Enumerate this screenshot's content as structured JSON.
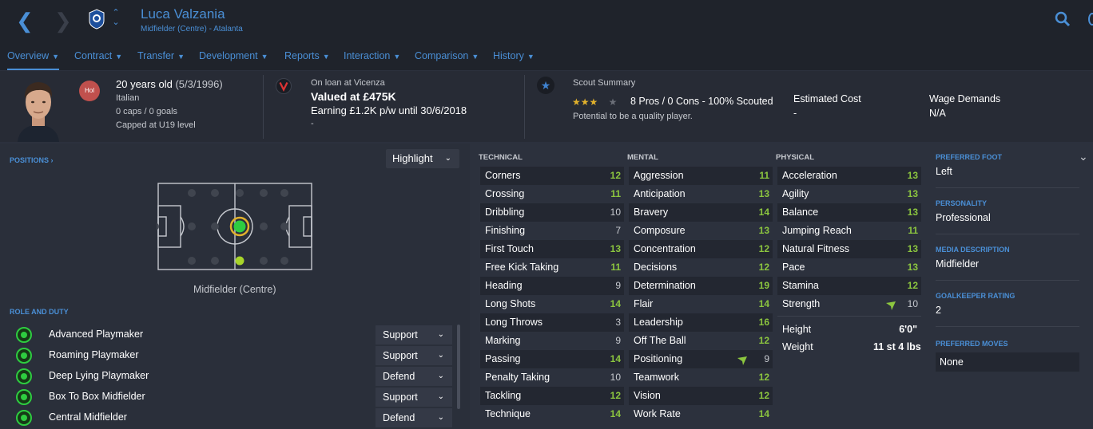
{
  "header": {
    "name": "Luca Valzania",
    "subtitle": "Midfielder (Centre) - Atalanta"
  },
  "tabs": [
    {
      "label": "Overview"
    },
    {
      "label": "Contract"
    },
    {
      "label": "Transfer"
    },
    {
      "label": "Development"
    },
    {
      "label": "Reports"
    },
    {
      "label": "Interaction"
    },
    {
      "label": "Comparison"
    },
    {
      "label": "History"
    }
  ],
  "profile": {
    "nation_code": "Hol",
    "age": "20 years old",
    "dob": "(5/3/1996)",
    "nationality": "Italian",
    "caps": "0 caps / 0 goals",
    "capped": "Capped at U19 level"
  },
  "value": {
    "loan": "On loan at Vicenza",
    "valued": "Valued at £475K",
    "earning": "Earning £1.2K p/w until 30/6/2018",
    "extra": "-"
  },
  "scout": {
    "title": "Scout Summary",
    "stars_filled": 3,
    "stars_total": 4,
    "summary": "8 Pros / 0 Cons - 100% Scouted",
    "potential": "Potential to be a quality player.",
    "estimated_cost_label": "Estimated Cost",
    "estimated_cost": "-",
    "wage_label": "Wage Demands",
    "wage": "N/A"
  },
  "positions": {
    "title": "POSITIONS",
    "highlight": "Highlight",
    "label": "Midfielder (Centre)"
  },
  "roles": {
    "title": "ROLE AND DUTY",
    "items": [
      {
        "name": "Advanced Playmaker",
        "duty": "Support"
      },
      {
        "name": "Roaming Playmaker",
        "duty": "Support"
      },
      {
        "name": "Deep Lying Playmaker",
        "duty": "Defend"
      },
      {
        "name": "Box To Box Midfielder",
        "duty": "Support"
      },
      {
        "name": "Central Midfielder",
        "duty": "Defend"
      }
    ]
  },
  "technical": {
    "title": "TECHNICAL",
    "attrs": [
      {
        "name": "Corners",
        "value": "12"
      },
      {
        "name": "Crossing",
        "value": "11"
      },
      {
        "name": "Dribbling",
        "value": "10"
      },
      {
        "name": "Finishing",
        "value": "7"
      },
      {
        "name": "First Touch",
        "value": "13"
      },
      {
        "name": "Free Kick Taking",
        "value": "11"
      },
      {
        "name": "Heading",
        "value": "9"
      },
      {
        "name": "Long Shots",
        "value": "14"
      },
      {
        "name": "Long Throws",
        "value": "3"
      },
      {
        "name": "Marking",
        "value": "9"
      },
      {
        "name": "Passing",
        "value": "14"
      },
      {
        "name": "Penalty Taking",
        "value": "10"
      },
      {
        "name": "Tackling",
        "value": "12"
      },
      {
        "name": "Technique",
        "value": "14"
      }
    ]
  },
  "mental": {
    "title": "MENTAL",
    "attrs": [
      {
        "name": "Aggression",
        "value": "11"
      },
      {
        "name": "Anticipation",
        "value": "13"
      },
      {
        "name": "Bravery",
        "value": "14"
      },
      {
        "name": "Composure",
        "value": "13"
      },
      {
        "name": "Concentration",
        "value": "12"
      },
      {
        "name": "Decisions",
        "value": "12"
      },
      {
        "name": "Determination",
        "value": "19"
      },
      {
        "name": "Flair",
        "value": "14"
      },
      {
        "name": "Leadership",
        "value": "16"
      },
      {
        "name": "Off The Ball",
        "value": "12"
      },
      {
        "name": "Positioning",
        "value": "9"
      },
      {
        "name": "Teamwork",
        "value": "12"
      },
      {
        "name": "Vision",
        "value": "12"
      },
      {
        "name": "Work Rate",
        "value": "14"
      }
    ]
  },
  "physical": {
    "title": "PHYSICAL",
    "attrs": [
      {
        "name": "Acceleration",
        "value": "13"
      },
      {
        "name": "Agility",
        "value": "13"
      },
      {
        "name": "Balance",
        "value": "13"
      },
      {
        "name": "Jumping Reach",
        "value": "11"
      },
      {
        "name": "Natural Fitness",
        "value": "13"
      },
      {
        "name": "Pace",
        "value": "13"
      },
      {
        "name": "Stamina",
        "value": "12"
      },
      {
        "name": "Strength",
        "value": "10"
      }
    ],
    "height_label": "Height",
    "height": "6'0\"",
    "weight_label": "Weight",
    "weight": "11 st 4 lbs"
  },
  "details": {
    "foot_label": "PREFERRED FOOT",
    "foot": "Left",
    "personality_label": "PERSONALITY",
    "personality": "Professional",
    "media_label": "MEDIA DESCRIPTION",
    "media": "Midfielder",
    "gk_label": "GOALKEEPER RATING",
    "gk": "2",
    "moves_label": "PREFERRED MOVES",
    "moves": "None"
  },
  "colors": {
    "accent": "#4a8fd6",
    "green_value": "#8cc63f",
    "grey_value": "#c6c9cf"
  }
}
